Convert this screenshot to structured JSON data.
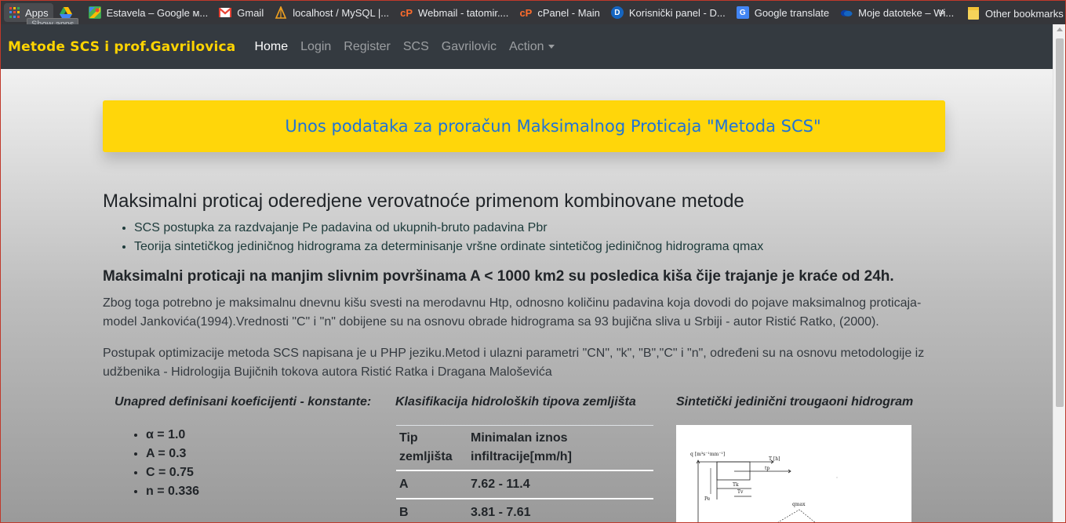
{
  "bookmarks": {
    "items": [
      {
        "label": "Apps",
        "icon": "apps-grid-icon"
      },
      {
        "label": "",
        "icon": "google-drive-icon"
      },
      {
        "label": "Estavela – Google м...",
        "icon": "google-maps-icon"
      },
      {
        "label": "Gmail",
        "icon": "gmail-icon"
      },
      {
        "label": "localhost / MySQL |...",
        "icon": "phpmyadmin-icon"
      },
      {
        "label": "Webmail - tatomir....",
        "icon": "cpanel-icon"
      },
      {
        "label": "cPanel - Main",
        "icon": "cpanel-icon"
      },
      {
        "label": "Korisnički panel - D...",
        "icon": "panel-icon"
      },
      {
        "label": "Google translate",
        "icon": "google-translate-icon"
      },
      {
        "label": "Moje datoteke – Wi...",
        "icon": "onedrive-icon"
      }
    ],
    "more": "»",
    "other": "Other bookmarks",
    "tooltip": "Show apps"
  },
  "navbar": {
    "brand": "Metode SCS i prof.Gavrilovica",
    "links": [
      "Home",
      "Login",
      "Register",
      "SCS",
      "Gavrilovic",
      "Action"
    ],
    "active": "Home"
  },
  "banner": {
    "text": "Unos podataka za proračun Maksimalnog Proticaja \"Metoda SCS\""
  },
  "main": {
    "heading": "Maksimalni proticaj oderedjene verovatnoće primenom kombinovane metode",
    "bullets": [
      "SCS postupka za razdvajanje Pe padavina od ukupnih-bruto padavina Pbr",
      "Teorija sintetičkog jediničnog hidrograma za determinisanje vršne ordinate sintetičog jediničnog hidrograma qmax"
    ],
    "subheading": "Maksimalni proticaji na manjim slivnim površinama A < 1000 km2 su posledica kiša čije trajanje je kraće od 24h.",
    "para1": "Zbog toga potrebno je maksimalnu dnevnu kišu svesti na merodavnu Htp, odnosno količinu padavina koja dovodi do pojave maksimalnog proticaja-model Jankovića(1994).Vrednosti \"C\" i \"n\" dobijene su na osnovu obrade hidrograma sa 93 bujična sliva u Srbiji - autor Ristić Ratko, (2000).",
    "para2": "Postupak optimizacije metoda SCS napisana je u PHP jeziku.Metod i ulazni parametri \"CN\", \"k\", \"B\",\"C\" i \"n\", određeni su na osnovu metodologije iz udžbenika - Hidrologija Bujičnih tokova autora Ristić Ratka i Dragana Maloševića"
  },
  "columns": {
    "constants_title": "Unapred definisani koeficijenti - konstante:",
    "constants": [
      "α = 1.0",
      "A = 0.3",
      "C = 0.75",
      "n = 0.336"
    ],
    "soil_title": "Klasifikacija hidroloških tipova zemljišta",
    "soil_headers": [
      "Tip zemljišta",
      "Minimalan iznos infiltracije[mm/h]"
    ],
    "soil_rows": [
      {
        "type": "A",
        "value": "7.62 - 11.4"
      },
      {
        "type": "B",
        "value": "3.81 - 7.61"
      }
    ],
    "hydro_title": "Sintetički jedinični trougaoni hidrogram",
    "hydro_labels": {
      "axis": "q [m³s⁻¹mm⁻¹]",
      "t": "T [h]",
      "tp": "tp",
      "tk": "Tk",
      "tv": "Tv",
      "pe": "Pe",
      "qmax": "qmax"
    }
  }
}
